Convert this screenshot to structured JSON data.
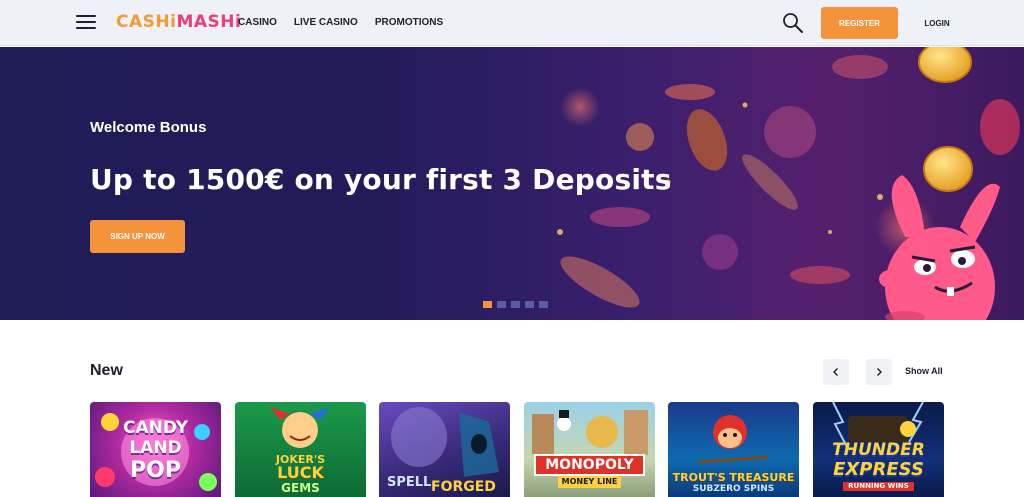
{
  "brand": {
    "logo_part1": "CASHi",
    "logo_part2": "MASHi"
  },
  "nav": [
    {
      "label": "CASINO"
    },
    {
      "label": "LIVE CASINO"
    },
    {
      "label": "PROMOTIONS"
    }
  ],
  "header": {
    "register_label": "REGISTER",
    "login_label": "LOGIN"
  },
  "hero": {
    "subtitle": "Welcome Bonus",
    "headline": "Up to 1500€ on your first 3 Deposits",
    "cta_label": "SIGN UP NOW",
    "slides_count": 5,
    "active_slide": 1
  },
  "new_section": {
    "title": "New",
    "show_all_label": "Show All"
  },
  "games": [
    {
      "line1": "CANDY",
      "line2": "LAND",
      "line3": "POP"
    },
    {
      "line1": "JOKER'S",
      "line2": "LUCK",
      "line3": "GEMS"
    },
    {
      "line1": "SPELL",
      "line2": "FORGED",
      "line3": ""
    },
    {
      "line1": "MONOPOLY",
      "line2": "MONEY LINE",
      "line3": ""
    },
    {
      "line1": "TROUT'S TREASURE",
      "line2": "SUBZERO SPINS",
      "line3": ""
    },
    {
      "line1": "THUNDER",
      "line2": "EXPRESS",
      "line3": "RUNNING WINS"
    }
  ],
  "colors": {
    "accent": "#f4933a",
    "header_bg": "#eef1f7",
    "hero_bg": "#241b5a",
    "text_dark": "#1e1f2c"
  },
  "icons": [
    "menu-icon",
    "search-icon",
    "chevron-left-icon",
    "chevron-right-icon"
  ]
}
